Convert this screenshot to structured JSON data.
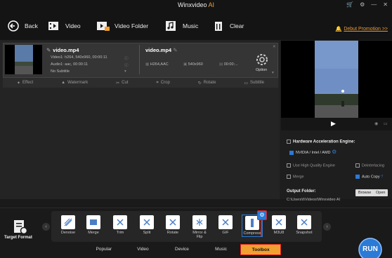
{
  "app": {
    "title": "Winxvideo",
    "title_ai": "AI"
  },
  "toolbar": {
    "back": "Back",
    "video": "Video",
    "video_folder": "Video Folder",
    "music": "Music",
    "clear": "Clear",
    "promo": "Debut Promotion >>"
  },
  "file": {
    "name": "video.mp4",
    "video_info": "Video1: h264, 540x960, 00:00:11",
    "audio_info": "Audio1: aac, 00:00:11",
    "subtitle": "No Subtitle",
    "out_name": "video.mp4",
    "out_codec": "H264,AAC",
    "out_res": "540x960",
    "out_time": "00:00:...",
    "option": "Option"
  },
  "edit": [
    "Effect",
    "Watermark",
    "Cut",
    "Crop",
    "Rotate",
    "Subtitle"
  ],
  "panel": {
    "hw_title": "Hardware Acceleration Engine:",
    "hw_opt": "NVIDIA / Intel / AMD",
    "hq": "Use High Quality Engine",
    "deint": "Deinterlacing",
    "merge": "Merge",
    "autocopy": "Auto Copy",
    "output_label": "Output Folder:",
    "output_path": "C:\\Users\\t\\Videos\\Winxvideo AI",
    "browse": "Browse",
    "open": "Open"
  },
  "bottom": {
    "target": "Target Format",
    "tools": [
      "Denoise",
      "Merge",
      "Trim",
      "Split",
      "Rotate",
      "Mirror & Flip",
      "GIF",
      "Compress",
      "M3U8",
      "Snapshot"
    ],
    "tabs": [
      "Popular",
      "Video",
      "Device",
      "Music",
      "Toolbox"
    ],
    "run": "RUN"
  }
}
